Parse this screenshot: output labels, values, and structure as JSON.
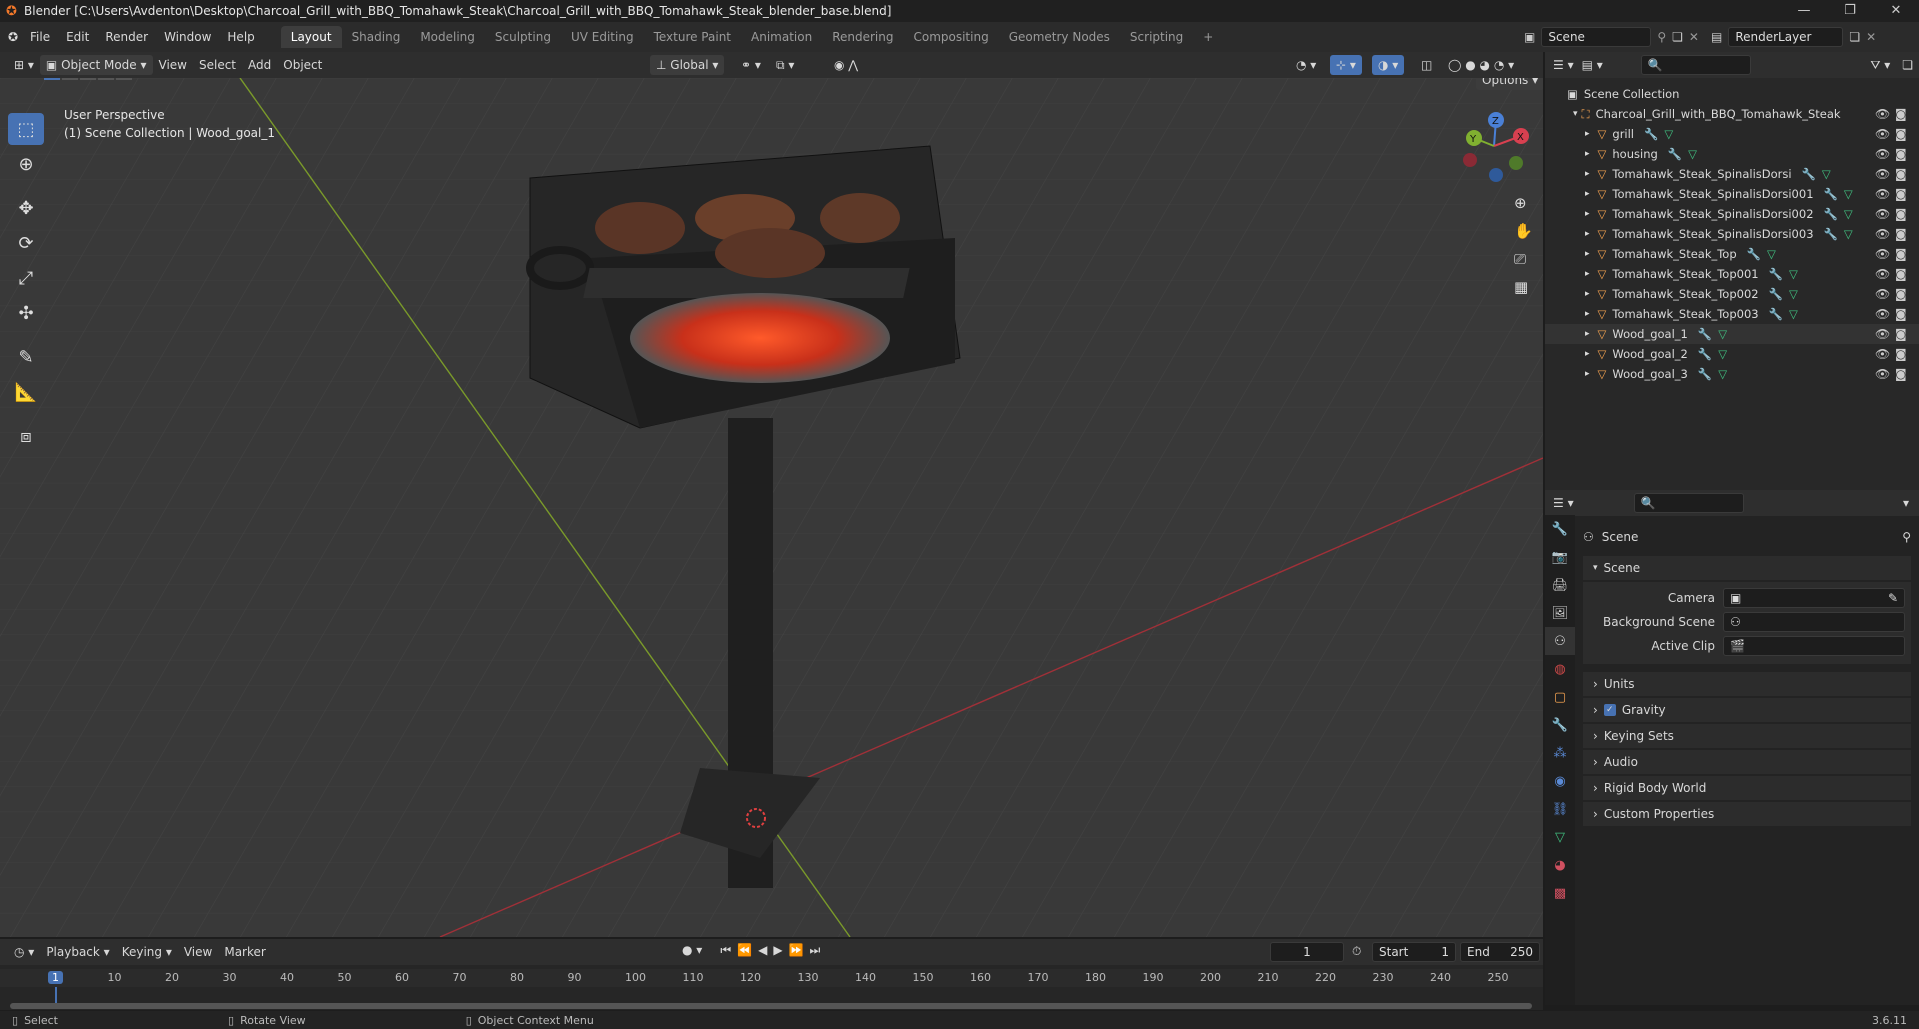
{
  "window": {
    "title": "Blender [C:\\Users\\Avdenton\\Desktop\\Charcoal_Grill_with_BBQ_Tomahawk_Steak\\Charcoal_Grill_with_BBQ_Tomahawk_Steak_blender_base.blend]",
    "min": "—",
    "max": "❐",
    "close": "✕"
  },
  "menus": [
    "File",
    "Edit",
    "Render",
    "Window",
    "Help"
  ],
  "workspaces": [
    "Layout",
    "Shading",
    "Modeling",
    "Sculpting",
    "UV Editing",
    "Texture Paint",
    "Animation",
    "Rendering",
    "Compositing",
    "Geometry Nodes",
    "Scripting"
  ],
  "scene": "Scene",
  "render_layer": "RenderLayer",
  "viewport": {
    "mode": "Object Mode",
    "view": "View",
    "select": "Select",
    "add": "Add",
    "object": "Object",
    "transform": "Global",
    "options": "Options",
    "perspective": "User Perspective",
    "collection": "(1) Scene Collection | Wood_goal_1",
    "axis_x": "X",
    "axis_y": "Y",
    "axis_z": "Z"
  },
  "outliner": {
    "root": "Scene Collection",
    "collection": "Charcoal_Grill_with_BBQ_Tomahawk_Steak",
    "items": [
      "grill",
      "housing",
      "Tomahawk_Steak_SpinalisDorsi",
      "Tomahawk_Steak_SpinalisDorsi001",
      "Tomahawk_Steak_SpinalisDorsi002",
      "Tomahawk_Steak_SpinalisDorsi003",
      "Tomahawk_Steak_Top",
      "Tomahawk_Steak_Top001",
      "Tomahawk_Steak_Top002",
      "Tomahawk_Steak_Top003",
      "Wood_goal_1",
      "Wood_goal_2",
      "Wood_goal_3"
    ]
  },
  "properties": {
    "title": "Scene",
    "section": "Scene",
    "camera_label": "Camera",
    "bg_label": "Background Scene",
    "clip_label": "Active Clip",
    "panels": [
      "Units",
      "Gravity",
      "Keying Sets",
      "Audio",
      "Rigid Body World",
      "Custom Properties"
    ]
  },
  "timeline": {
    "playback": "Playback",
    "keying": "Keying",
    "view": "View",
    "marker": "Marker",
    "current": "1",
    "start_label": "Start",
    "start": "1",
    "end_label": "End",
    "end": "250",
    "ticks": [
      "1",
      "10",
      "20",
      "30",
      "40",
      "50",
      "60",
      "70",
      "80",
      "90",
      "100",
      "110",
      "120",
      "130",
      "140",
      "150",
      "160",
      "170",
      "180",
      "190",
      "200",
      "210",
      "220",
      "230",
      "240",
      "250"
    ]
  },
  "status": {
    "select": "Select",
    "rotate": "Rotate View",
    "context": "Object Context Menu",
    "version": "3.6.11"
  }
}
